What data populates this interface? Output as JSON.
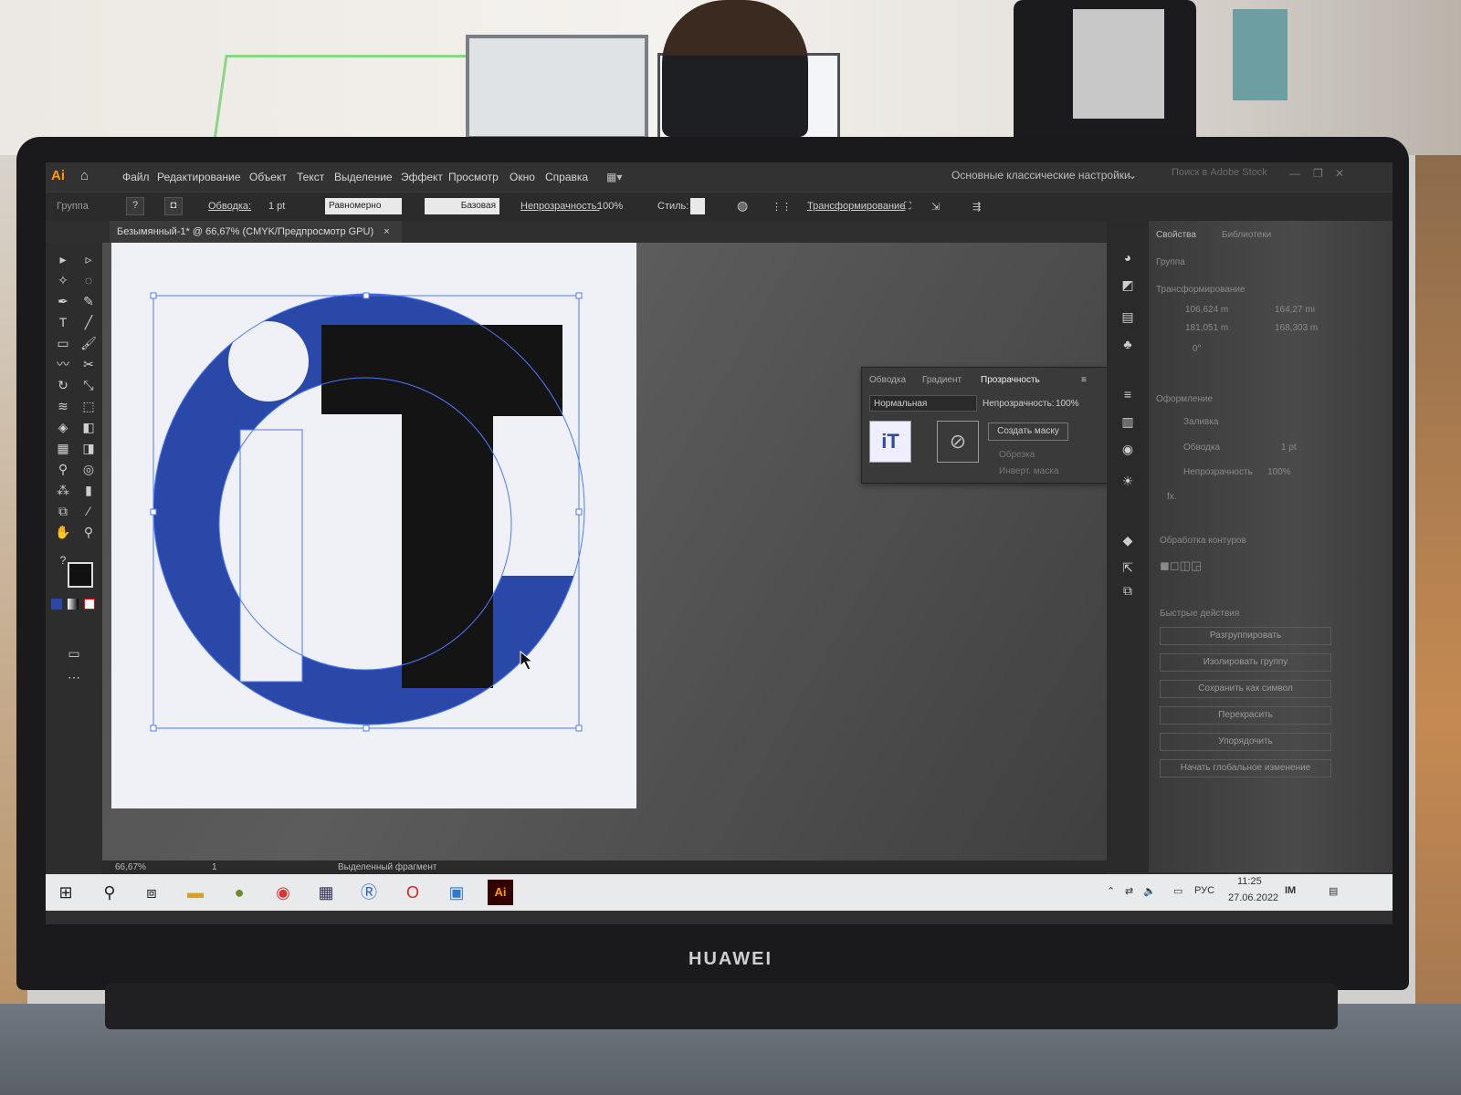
{
  "menubar": {
    "app_logo": "Ai",
    "items": [
      "Файл",
      "Редактирование",
      "Объект",
      "Текст",
      "Выделение",
      "Эффект",
      "Просмотр",
      "Окно",
      "Справка"
    ],
    "workspace": "Основные классические настройки",
    "search_placeholder": "Поиск в Adobe Stock"
  },
  "control_bar": {
    "selection_type": "Группа",
    "stroke_label": "Обводка:",
    "stroke_value": "1 pt",
    "profile": "Равномерно",
    "brush": "Базовая",
    "opacity_label": "Непрозрачность:",
    "opacity_value": "100%",
    "style_label": "Стиль:",
    "transform_label": "Трансформирование"
  },
  "document_tab": {
    "title": "Безымянный-1* @ 66,67% (CMYK/Предпросмотр GPU)",
    "close": "×"
  },
  "transparency_panel": {
    "tabs": [
      "Обводка",
      "Градиент",
      "Прозрачность"
    ],
    "blend_mode": "Нормальная",
    "opacity_label": "Непрозрачность:",
    "opacity_value": "100%",
    "create_mask": "Создать маску",
    "clip": "Обрезка",
    "invert": "Инверт. маска"
  },
  "properties_panel": {
    "tabs": [
      "Свойства",
      "Библиотеки"
    ],
    "group": "Группа",
    "transform": "Трансформирование",
    "x": "106,624 m",
    "w": "164,27 mi",
    "y": "181,051 m",
    "h": "168,303 m",
    "angle": "0°",
    "appearance": "Оформление",
    "fill": "Заливка",
    "stroke": "Обводка",
    "stroke_value": "1 pt",
    "opacity": "Непрозрачность",
    "opacity_value": "100%",
    "fx": "fx.",
    "pathfinder": "Обработка контуров",
    "quick_actions": "Быстрые действия",
    "buttons": [
      "Разгруппировать",
      "Изолировать группу",
      "Сохранить как символ",
      "Перекрасить",
      "Упорядочить",
      "Начать глобальное изменение"
    ]
  },
  "status_bar": {
    "zoom": "66,67%",
    "page": "1",
    "selection": "Выделенный фрагмент"
  },
  "taskbar": {
    "lang": "РУС",
    "time": "11:25",
    "date": "27.06.2022"
  },
  "device": {
    "brand": "HUAWEI"
  },
  "colors": {
    "logo_blue": "#2a48a8",
    "logo_black": "#141414",
    "selection_blue": "#4d79ff",
    "ai_orange": "#ff9a00"
  }
}
